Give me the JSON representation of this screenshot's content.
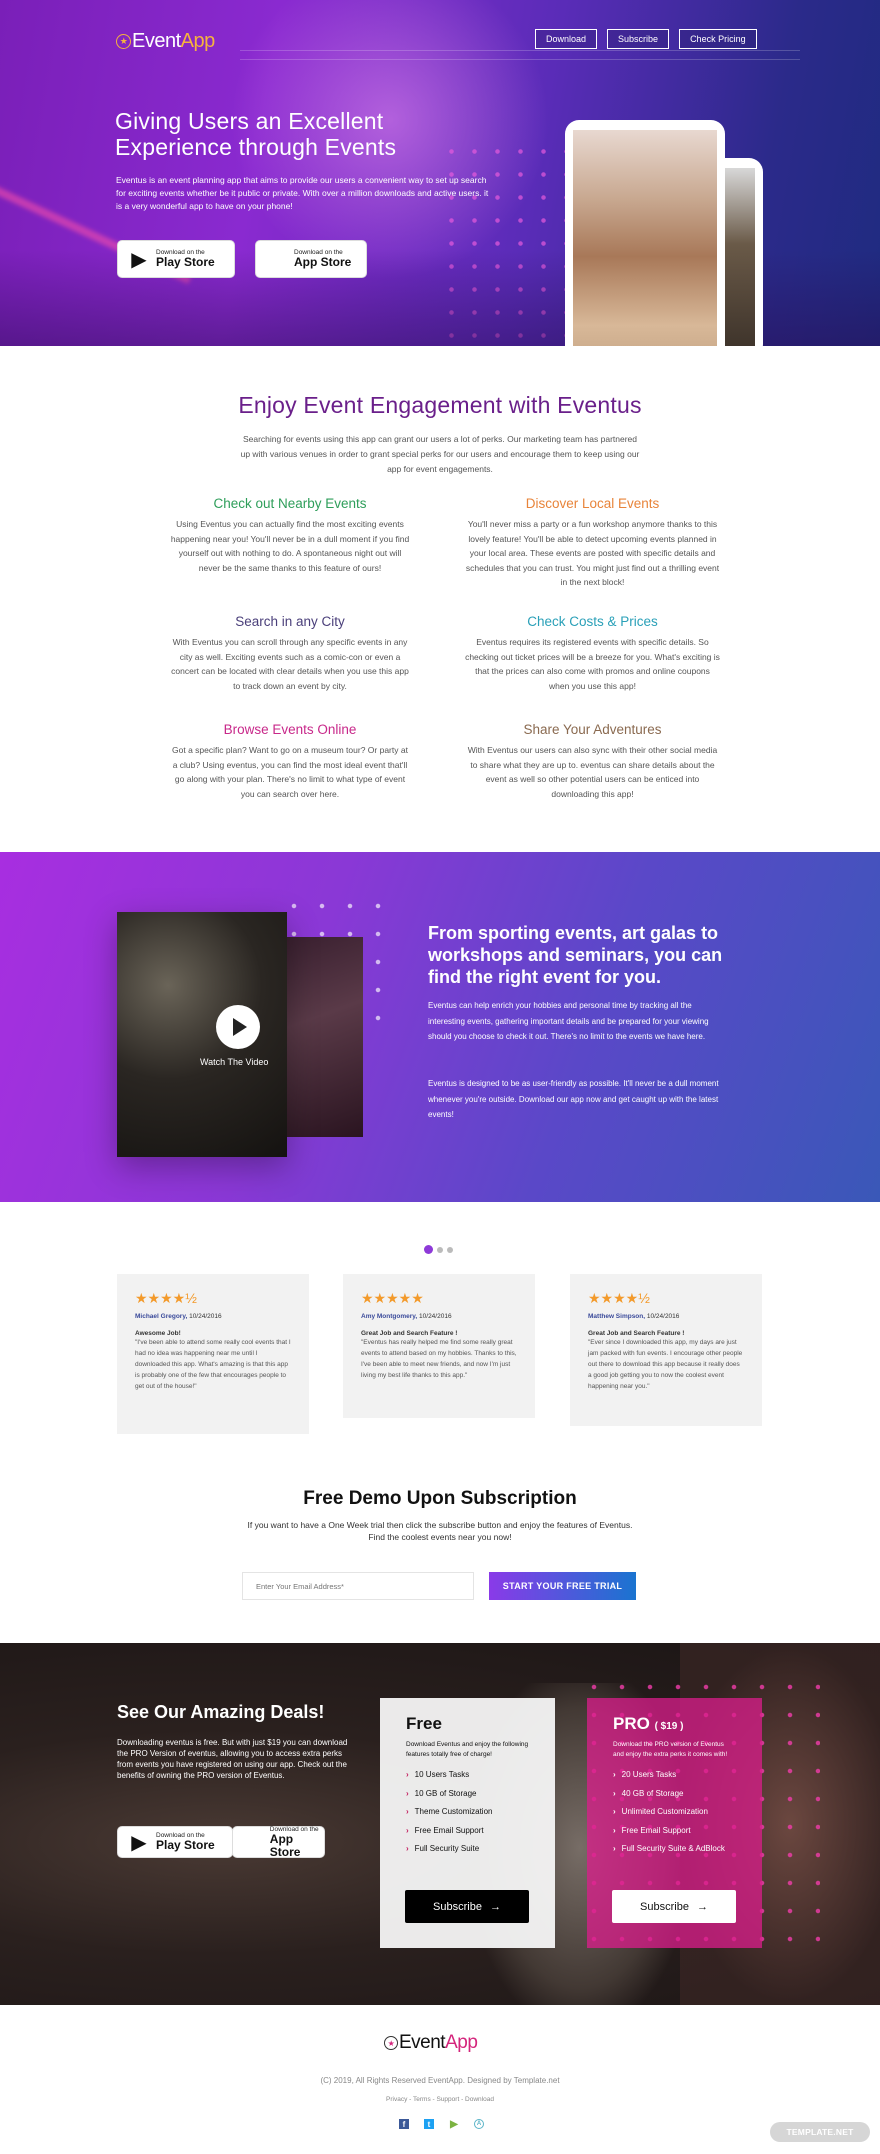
{
  "brand": {
    "name_part1": "Event",
    "name_part2": "App",
    "logo_icon": "star-circle-icon"
  },
  "nav": {
    "items": [
      {
        "label": "Download"
      },
      {
        "label": "Subscribe"
      },
      {
        "label": "Check Pricing"
      }
    ]
  },
  "hero": {
    "title": "Giving Users an Excellent Experience through Events",
    "description": "Eventus is an event planning app that aims to provide our users a convenient way to set up search for exciting events whether be it public or private. With over a million downloads and active users. it is a very wonderful app to have on your phone!",
    "play_store": {
      "small": "Download on the",
      "big": "Play Store",
      "icon": "play-store-icon"
    },
    "app_store": {
      "small": "Download on the",
      "big": "App Store",
      "icon": "apple-icon"
    }
  },
  "features": {
    "title": "Enjoy Event Engagement with Eventus",
    "intro": "Searching for events using this app can grant our users a lot of perks. Our marketing team has partnered up with various venues in order to grant special perks for our users and encourage them to keep using our app for event engagements.",
    "items": [
      {
        "title": "Check out Nearby Events",
        "color": "#2e9e5a",
        "text": "Using Eventus you can actually find the most exciting events happening near you! You'll never be in a dull moment if you find yourself out with nothing to do. A spontaneous night out will never be the same thanks to this feature of ours!"
      },
      {
        "title": "Discover Local Events",
        "color": "#e8843a",
        "text": "You'll never miss a party or a fun workshop anymore thanks to this lovely feature! You'll be able to detect upcoming events planned in your local area. These events are posted with specific details and schedules that you can trust. You might just find out a thrilling event in the next block!"
      },
      {
        "title": "Search in any City",
        "color": "#4a3f7a",
        "text": "With Eventus you can scroll through any specific events in any city as well. Exciting events such as a comic-con or even a concert can be located with clear details when you use this app to track down an event by city."
      },
      {
        "title": "Check Costs & Prices",
        "color": "#2aa0b8",
        "text": "Eventus requires its registered events with specific details. So checking out ticket prices will be a breeze for you. What's exciting is that the prices can also come with promos and online coupons when you use this app!"
      },
      {
        "title": "Browse Events Online",
        "color": "#c8288a",
        "text": "Got a specific plan? Want to go on a museum tour? Or party at a club? Using eventus, you can find the most ideal event that'll go along with your plan. There's no limit to what type of event you can search over here."
      },
      {
        "title": "Share Your Adventures",
        "color": "#8a6a50",
        "text": "With Eventus our users can also sync with their other social media to share what they are up to. eventus can share details about the event as well so other potential users can be enticed into downloading this app!"
      }
    ]
  },
  "video": {
    "watch_label": "Watch The Video",
    "title": "From sporting events, art galas to workshops and seminars, you can find the right event for you.",
    "paragraph1": "Eventus can help enrich your hobbies and personal time by tracking all the interesting events, gathering important details and be prepared for your viewing should you choose to check it out. There's no limit to the events we have here.",
    "paragraph2": "Eventus is designed to be as user-friendly as possible. It'll never be a dull moment whenever you're outside. Download our app now and get caught up with the latest events!"
  },
  "testimonials": {
    "carousel_pages": 3,
    "active_page": 1,
    "reviews": [
      {
        "stars": "★★★★½",
        "rating": 4.5,
        "name": "Michael Gregory,",
        "date": "10/24/2016",
        "title": "Awesome Job!",
        "text": "\"I've been able to attend some really cool events that I had no idea was happening near me until I downloaded this app. What's amazing is that this app is probably one of the few that encourages people to get out of the house!\""
      },
      {
        "stars": "★★★★★",
        "rating": 5,
        "name": "Amy Montgomery,",
        "date": "10/24/2016",
        "title": "Great Job and Search Feature !",
        "text": "\"Eventus has really helped me find some really great events to attend based on my hobbies. Thanks to this, I've been able to meet new friends, and now I'm just living my best life thanks to this app.\""
      },
      {
        "stars": "★★★★½",
        "rating": 4.5,
        "name": "Matthew Simpson,",
        "date": "10/24/2016",
        "title": "Great Job and Search Feature !",
        "text": "\"Ever since I downloaded this app, my days are just jam packed with fun events. I encourage other people out there to download this app because it really does a good job getting you to now the coolest event happening near you.\""
      }
    ]
  },
  "subscribe": {
    "title": "Free Demo Upon Subscription",
    "text": "If you want to have a One Week trial then click the subscribe button and enjoy the features of Eventus. Find the coolest events near you now!",
    "email_placeholder": "Enter Your Email Address*",
    "button_label": "START YOUR FREE TRIAL"
  },
  "deals": {
    "title": "See Our Amazing Deals!",
    "text": "Downloading eventus is free. But with just $19 you can download the PRO Version of eventus, allowing you to access extra perks from events you have registered on using our app. Check out the benefits of owning the PRO version of Eventus.",
    "play_store": {
      "small": "Download on the",
      "big": "Play Store"
    },
    "app_store": {
      "small": "Download on the",
      "big": "App Store"
    },
    "plans": [
      {
        "name": "Free",
        "price": "",
        "description": "Download Eventus and enjoy the following features totally free of charge!",
        "features": [
          "10 Users Tasks",
          "10 GB of Storage",
          "Theme Customization",
          "Free Email Support",
          "Full Security Suite"
        ],
        "button": "Subscribe"
      },
      {
        "name": "PRO",
        "price": "( $19 )",
        "description": "Download the PRO version of Eventus and enjoy the extra perks it comes with!",
        "features": [
          "20 Users Tasks",
          "40 GB of Storage",
          "Unlimited Customization",
          "Free Email Support",
          "Full Security Suite & AdBlock"
        ],
        "button": "Subscribe"
      }
    ]
  },
  "footer": {
    "copyright": "(C) 2019, All Rights Reserved EventApp. Designed by Template.net",
    "links": [
      "Privacy",
      "Terms",
      "Support",
      "Download"
    ],
    "separator": " - ",
    "social": [
      {
        "name": "facebook-icon",
        "glyph": "f",
        "color": "#3b5998"
      },
      {
        "name": "twitter-icon",
        "glyph": "t",
        "color": "#1da1f2"
      },
      {
        "name": "google-play-icon",
        "glyph": "▶",
        "color": "#7cb342"
      },
      {
        "name": "app-store-icon",
        "glyph": "A",
        "color": "#5ab4c8"
      }
    ],
    "badge": "TEMPLATE.NET"
  }
}
